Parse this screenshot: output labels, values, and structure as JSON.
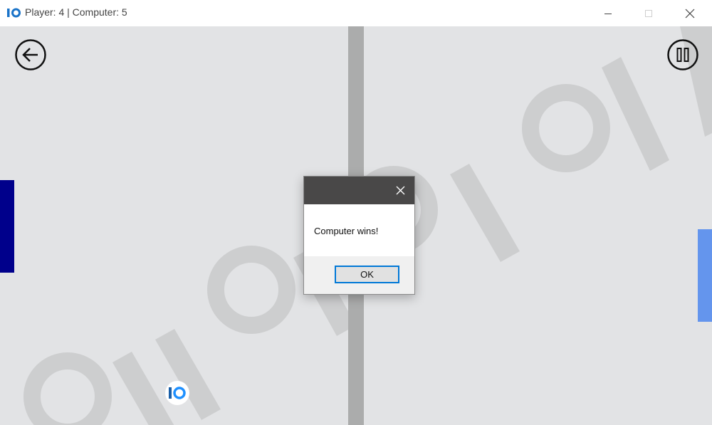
{
  "window": {
    "title": "Player: 4 | Computer: 5",
    "logo_icon": "io-logo-icon",
    "controls": [
      "minimize-icon",
      "maximize-icon",
      "close-icon"
    ]
  },
  "game": {
    "background_color": "#e2e3e5",
    "divider_color": "#abacac",
    "player_paddle_color": "#00008b",
    "computer_paddle_color": "#6495ed",
    "back_icon": "arrow-left-circle-icon",
    "pause_icon": "pause-circle-icon",
    "ball_icon": "io-logo-icon",
    "watermark_icon": "io-logo-watermark"
  },
  "dialog": {
    "message": "Computer wins!",
    "ok_label": "OK",
    "close_icon": "close-icon",
    "titlebar_color": "#494848",
    "accent_color": "#0078d7"
  }
}
